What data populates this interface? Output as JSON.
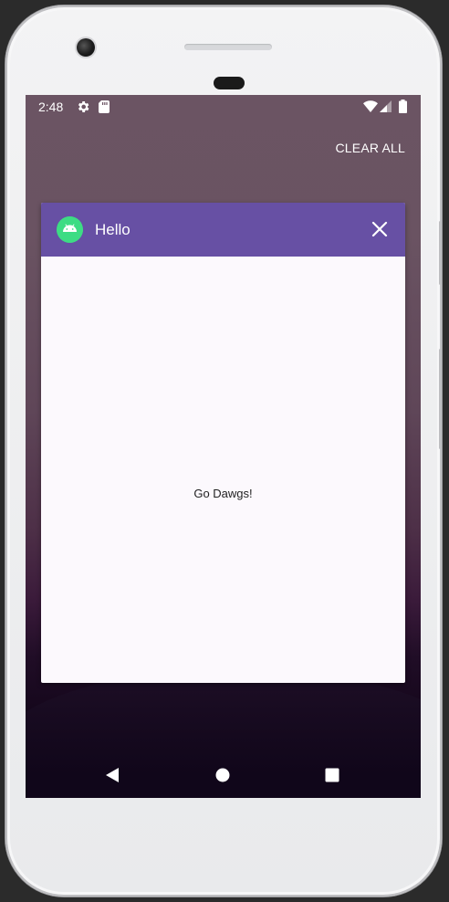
{
  "status_bar": {
    "time": "2:48",
    "icons": [
      "settings-icon",
      "sd-card-icon",
      "wifi-icon",
      "cell-signal-icon",
      "battery-icon"
    ]
  },
  "recents": {
    "clear_all_label": "CLEAR ALL"
  },
  "task_card": {
    "title": "Hello",
    "app_icon": "android-icon",
    "close_icon": "close-icon",
    "header_color": "#6750a4",
    "body_text": "Go Dawgs!"
  },
  "nav_bar": {
    "icons": [
      "back-icon",
      "home-icon",
      "recents-icon"
    ]
  }
}
